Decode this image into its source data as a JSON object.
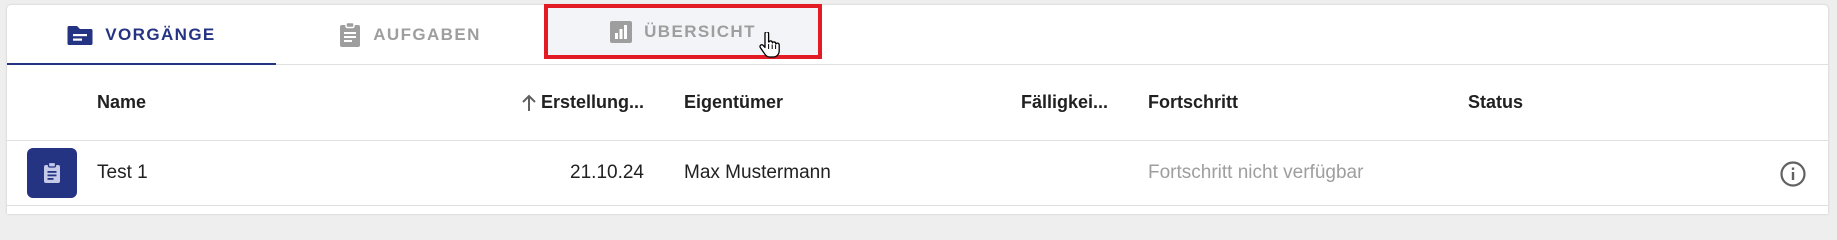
{
  "tabs": [
    {
      "label": "VORGÄNGE",
      "icon": "folder-icon",
      "active": true
    },
    {
      "label": "AUFGABEN",
      "icon": "clipboard-icon",
      "active": false
    },
    {
      "label": "ÜBERSICHT",
      "icon": "bar-chart-icon",
      "active": false,
      "hovered": true
    }
  ],
  "table": {
    "columns": [
      "Name",
      "Erstellung...",
      "Eigentümer",
      "Fälligkei...",
      "Fortschritt",
      "Status"
    ],
    "sort": {
      "column": "Erstellung...",
      "direction": "ascending"
    },
    "rows": [
      {
        "icon": "clipboard-icon",
        "name": "Test 1",
        "created": "21.10.24",
        "owner": "Max Mustermann",
        "due": "",
        "progress": "Fortschritt nicht verfügbar",
        "status": ""
      }
    ]
  },
  "colors": {
    "primary": "#253383",
    "muted": "#9e9e9e",
    "highlight": "#e21b24"
  }
}
